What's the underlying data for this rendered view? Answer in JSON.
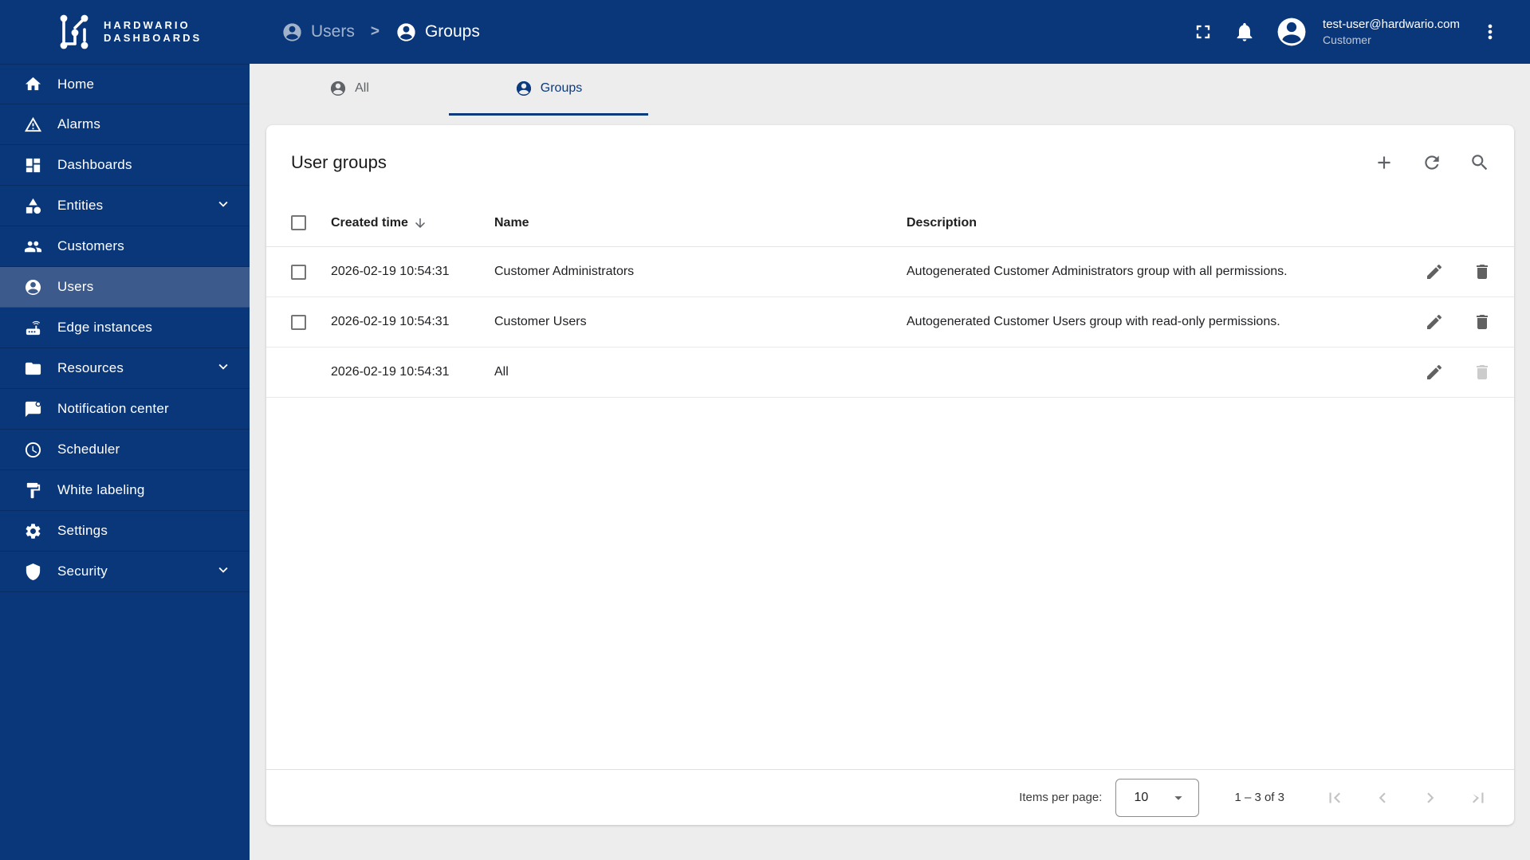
{
  "brand": {
    "line1": "HARDWARIO",
    "line2": "DASHBOARDS"
  },
  "header": {
    "breadcrumb": [
      {
        "label": "Users"
      },
      {
        "label": "Groups"
      }
    ],
    "separator": ">",
    "user": {
      "email": "test-user@hardwario.com",
      "role": "Customer"
    }
  },
  "sidebar": {
    "items": [
      {
        "label": "Home",
        "icon": "home",
        "active": false,
        "expandable": false
      },
      {
        "label": "Alarms",
        "icon": "warning",
        "active": false,
        "expandable": false
      },
      {
        "label": "Dashboards",
        "icon": "dashboard",
        "active": false,
        "expandable": false
      },
      {
        "label": "Entities",
        "icon": "category",
        "active": false,
        "expandable": true
      },
      {
        "label": "Customers",
        "icon": "people",
        "active": false,
        "expandable": false
      },
      {
        "label": "Users",
        "icon": "account-circle",
        "active": true,
        "expandable": false
      },
      {
        "label": "Edge instances",
        "icon": "router",
        "active": false,
        "expandable": false
      },
      {
        "label": "Resources",
        "icon": "folder",
        "active": false,
        "expandable": true
      },
      {
        "label": "Notification center",
        "icon": "chat-unread",
        "active": false,
        "expandable": false
      },
      {
        "label": "Scheduler",
        "icon": "clock",
        "active": false,
        "expandable": false
      },
      {
        "label": "White labeling",
        "icon": "paint",
        "active": false,
        "expandable": false
      },
      {
        "label": "Settings",
        "icon": "gear",
        "active": false,
        "expandable": false
      },
      {
        "label": "Security",
        "icon": "shield",
        "active": false,
        "expandable": true
      }
    ]
  },
  "tabs": [
    {
      "label": "All",
      "active": false
    },
    {
      "label": "Groups",
      "active": true
    }
  ],
  "table": {
    "title": "User groups",
    "columns": [
      "Created time",
      "Name",
      "Description"
    ],
    "sorted_by": "Created time",
    "sort_direction": "desc",
    "rows": [
      {
        "created": "2026-02-19 10:54:31",
        "name": "Customer Administrators",
        "description": "Autogenerated Customer Administrators group with all permissions.",
        "selectable": true,
        "deletable": true
      },
      {
        "created": "2026-02-19 10:54:31",
        "name": "Customer Users",
        "description": "Autogenerated Customer Users group with read-only permissions.",
        "selectable": true,
        "deletable": true
      },
      {
        "created": "2026-02-19 10:54:31",
        "name": "All",
        "description": "",
        "selectable": false,
        "deletable": false
      }
    ]
  },
  "paginator": {
    "items_per_page_label": "Items per page:",
    "items_per_page": "10",
    "range_label": "1 – 3 of 3"
  },
  "colors": {
    "primary": "#0a377a",
    "sidebar_active": "#3c5a8c",
    "tab_active": "#0c3a7d",
    "content_bg": "#ededed",
    "icon_gray": "#5f6368",
    "disabled_gray": "#c3c3c3"
  }
}
